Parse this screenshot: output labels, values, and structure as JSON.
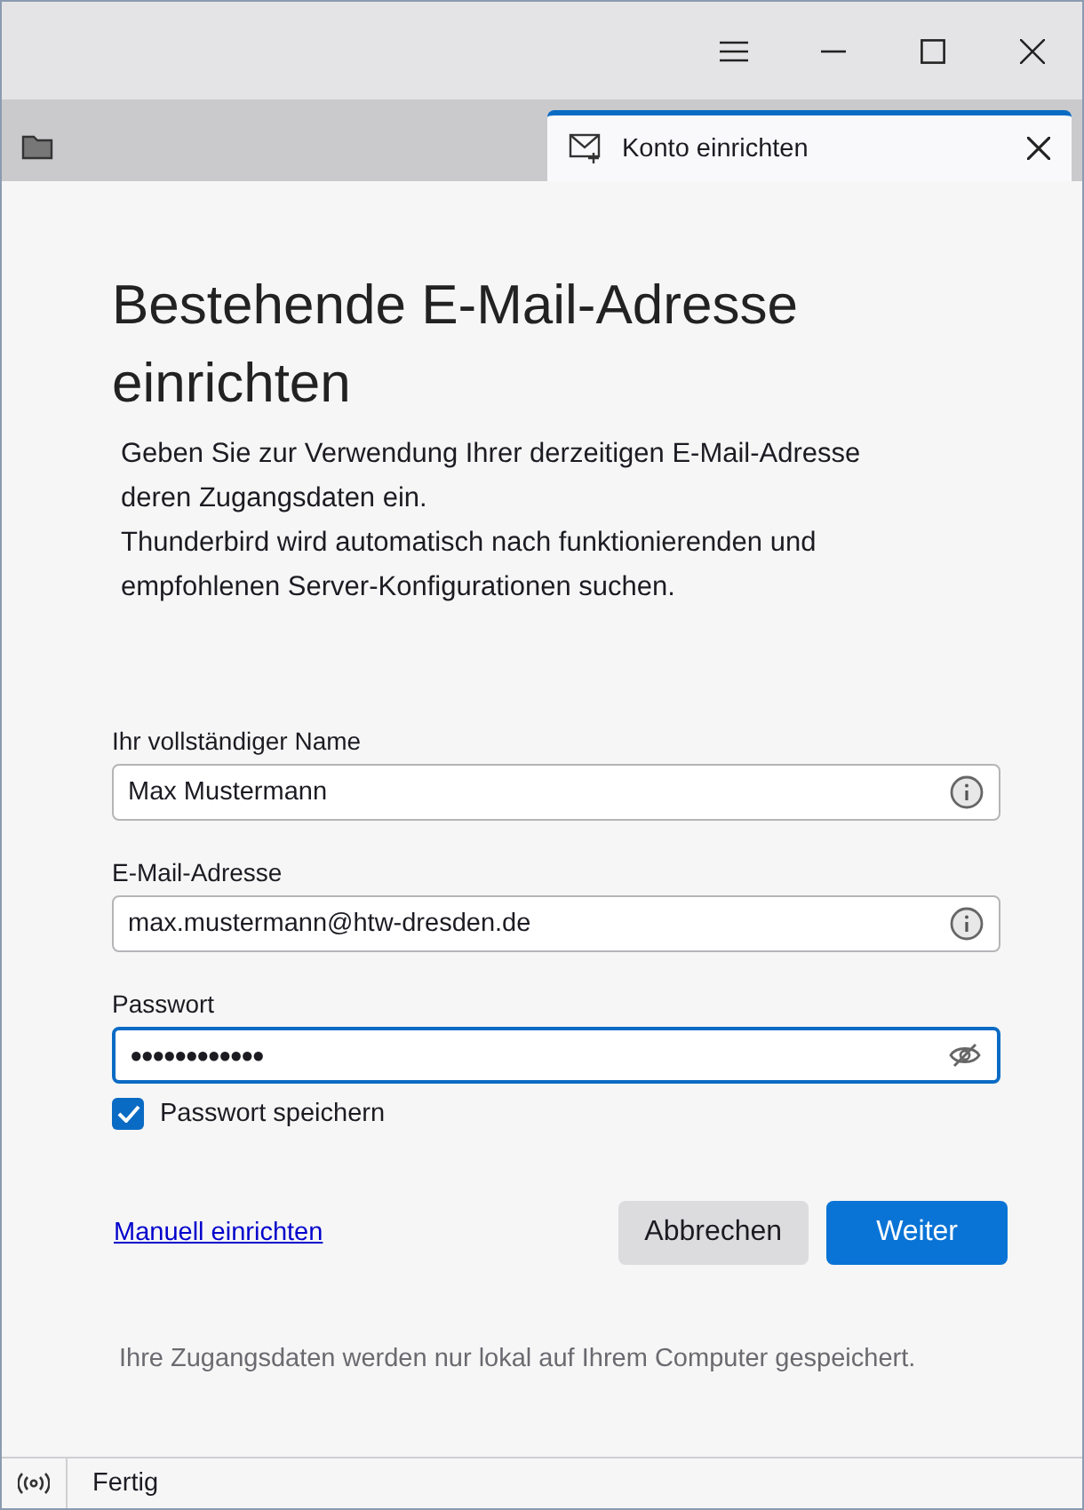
{
  "tabs": [
    {
      "kind": "folder",
      "selected": false
    },
    {
      "kind": "account",
      "label": "Konto einrichten",
      "selected": true
    }
  ],
  "heading": "Bestehende E-Mail-Adresse einrichten",
  "intro": [
    "Geben Sie zur Verwendung Ihrer derzeitigen E-Mail-Adresse deren Zugangsdaten ein.",
    "Thunderbird wird automatisch nach funktionierenden und empfohlenen Server-Konfigurationen suchen."
  ],
  "fields": [
    {
      "label": "Ihr vollständiger Name",
      "value": "Max Mustermann",
      "kind": "info",
      "focused": false
    },
    {
      "label": "E-Mail-Adresse",
      "value": "max.mustermann@htw-dresden.de",
      "kind": "info",
      "focused": false
    },
    {
      "label": "Passwort",
      "value": "●●●●●●●●●●●●",
      "kind": "password",
      "focused": true
    }
  ],
  "remember": {
    "label": "Passwort speichern",
    "checked": true
  },
  "manual_link": "Manuell einrichten",
  "buttons": [
    {
      "label": "Abbrechen",
      "kind": "secondary"
    },
    {
      "label": "Weiter",
      "kind": "primary"
    }
  ],
  "note": "Ihre Zugangsdaten werden nur lokal auf Ihrem Computer gespeichert.",
  "status_bar": {
    "text": "Fertig"
  }
}
